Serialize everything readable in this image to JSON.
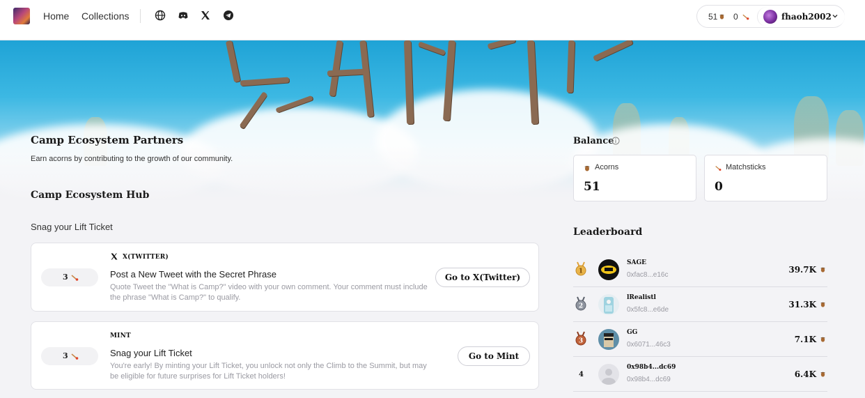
{
  "nav": {
    "home": "Home",
    "collections": "Collections",
    "social_icons": [
      "globe-icon",
      "discord-icon",
      "x-icon",
      "telegram-icon"
    ],
    "acorn_count": "51",
    "matchstick_count": "0",
    "username": "fhaoh2002"
  },
  "hero": {
    "title": "Camp Ecosystem Partners",
    "subtitle": "Earn acorns by contributing to the growth of our community."
  },
  "hub": {
    "title": "Camp Ecosystem Hub",
    "section_label": "Snag your Lift Ticket",
    "tasks": [
      {
        "reward": "3",
        "platform": "X(TWITTER)",
        "title": "Post a New Tweet with the Secret Phrase",
        "description": "Quote Tweet the \"What is Camp?\" video with your own comment. Your comment must include the phrase \"What is Camp?\" to qualify.",
        "cta": "Go to X(Twitter)"
      },
      {
        "reward": "3",
        "platform": "MINT",
        "title": "Snag your Lift Ticket",
        "description": "You're early! By minting your Lift Ticket, you unlock not only the Climb to the Summit, but may be eligible for future surprises for Lift Ticket holders!",
        "cta": "Go to Mint"
      }
    ]
  },
  "balance": {
    "title": "Balance",
    "acorns_label": "Acorns",
    "acorns_value": "51",
    "matchsticks_label": "Matchsticks",
    "matchsticks_value": "0"
  },
  "leaderboard": {
    "title": "Leaderboard",
    "rows": [
      {
        "rank": "1",
        "name": "SAGE",
        "address": "0xfac8...e16c",
        "score": "39.7K"
      },
      {
        "rank": "2",
        "name": "lRealistl",
        "address": "0x5fc8...e6de",
        "score": "31.3K"
      },
      {
        "rank": "3",
        "name": "GG",
        "address": "0x6071...46c3",
        "score": "7.1K"
      },
      {
        "rank": "4",
        "name": "0x98b4...dc69",
        "address": "0x98b4...dc69",
        "score": "6.4K"
      }
    ]
  },
  "colors": {
    "acorn": "#8a5a2b",
    "matchstick": "#e0452a",
    "gold": "#e0a33a",
    "silver": "#7a7f8a",
    "bronze": "#b5532f"
  }
}
